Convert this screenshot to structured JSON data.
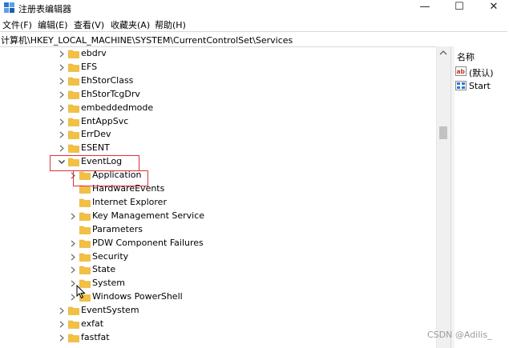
{
  "window": {
    "title": "注册表编辑器",
    "minimize_glyph": "—",
    "maximize_glyph": "☐",
    "close_glyph": "✕"
  },
  "menu": [
    "文件(F)",
    "编辑(E)",
    "查看(V)",
    "收藏夹(A)",
    "帮助(H)"
  ],
  "address": "计算机\\HKEY_LOCAL_MACHINE\\SYSTEM\\CurrentControlSet\\Services",
  "tree": {
    "above": [
      "ebdrv",
      "EFS",
      "EhStorClass",
      "EhStorTcgDrv",
      "embeddedmode",
      "EntAppSvc",
      "ErrDev",
      "ESENT"
    ],
    "expanded": "EventLog",
    "children": [
      "Application",
      "HardwareEvents",
      "Internet Explorer",
      "Key Management Service",
      "Parameters",
      "PDW Component Failures",
      "Security",
      "State",
      "System",
      "Windows PowerShell"
    ],
    "below": [
      "EventSystem",
      "exfat",
      "fastfat"
    ]
  },
  "values_pane": {
    "header": "名称",
    "items": [
      {
        "label": "(默认)",
        "icon": "string-value-icon"
      },
      {
        "label": "Start",
        "icon": "binary-value-icon"
      }
    ]
  },
  "colors": {
    "folder": "#f4c042",
    "highlight": "#e0303a",
    "scroll_thumb": "#c2c2c2"
  },
  "watermark": "CSDN @Adilis_"
}
